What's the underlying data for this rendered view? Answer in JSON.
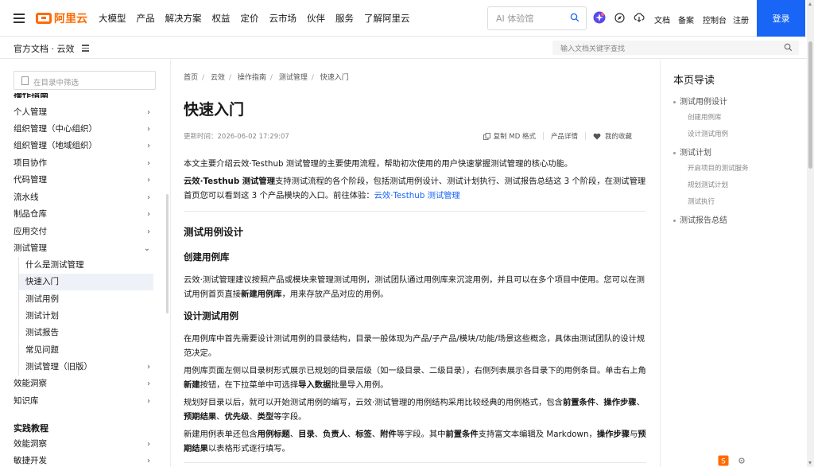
{
  "brand": {
    "logo_text": "阿里云",
    "color": "#ff6a00"
  },
  "topnav": {
    "items": [
      "大模型",
      "产品",
      "解决方案",
      "权益",
      "定价",
      "云市场",
      "伙伴",
      "服务",
      "了解阿里云"
    ],
    "ai_search_placeholder": "AI 体验馆",
    "links": [
      "文档",
      "备案",
      "控制台",
      "注册"
    ],
    "login": "登录",
    "login_color": "#1865f6"
  },
  "subbar": {
    "crumb": "官方文档 · 云效",
    "doc_search_placeholder": "输入文档关键字查找"
  },
  "sidebar": {
    "filter_placeholder": "在目录中筛选",
    "cut_heading": "操作指南",
    "items": [
      {
        "label": "个人管理",
        "chevron": "›"
      },
      {
        "label": "组织管理（中心组织）",
        "chevron": "›"
      },
      {
        "label": "组织管理（地域组织）",
        "chevron": "›"
      },
      {
        "label": "项目协作",
        "chevron": "›"
      },
      {
        "label": "代码管理",
        "chevron": "›"
      },
      {
        "label": "流水线",
        "chevron": "›"
      },
      {
        "label": "制品仓库",
        "chevron": "›"
      },
      {
        "label": "应用交付",
        "chevron": "›"
      },
      {
        "label": "测试管理",
        "chevron": "⌄"
      }
    ],
    "children": [
      {
        "label": "什么是测试管理"
      },
      {
        "label": "快速入门"
      },
      {
        "label": "测试用例"
      },
      {
        "label": "测试计划"
      },
      {
        "label": "测试报告"
      },
      {
        "label": "常见问题"
      },
      {
        "label": "测试管理（旧版）",
        "chevron": "›"
      }
    ],
    "after": [
      {
        "label": "效能洞察",
        "chevron": "›"
      },
      {
        "label": "知识库",
        "chevron": "›"
      }
    ],
    "section2": "实践教程",
    "section2_items": [
      {
        "label": "效能洞察",
        "chevron": "›"
      },
      {
        "label": "敏捷开发",
        "chevron": "›"
      }
    ]
  },
  "main": {
    "breadcrumb": [
      "首页",
      "云效",
      "操作指南",
      "测试管理",
      "快速入门"
    ],
    "title": "快速入门",
    "updated": "更新时间：2026-06-02 17:29:07",
    "actions": {
      "copy": "复制 MD 格式",
      "detail": "产品详情",
      "fav": "我的收藏"
    },
    "intro": "本文主要介绍云效·Testhub 测试管理的主要使用流程，帮助初次使用的用户快速掌握测试管理的核心功能。",
    "p2_bold": "云效·Testhub 测试管理",
    "p2_text": "支持测试流程的各个阶段，包括测试用例设计、测试计划执行、测试报告总结这 3 个阶段，在测试管理首页您可以看到这 3 个产品模块的入口。前往体验：",
    "p2_link": "云效·Testhub 测试管理",
    "h_case_design": "测试用例设计",
    "h_create_lib": "创建用例库",
    "p3_a": "云效·测试管理建议按照产品或模块来管理测试用例，测试团队通过用例库来沉淀用例，并且可以在多个项目中使用。您可以在测试用例首页直接",
    "p3_b": "新建用例库",
    "p3_c": "，用来存放产品对应的用例。",
    "h_design_case": "设计测试用例",
    "p4": "在用例库中首先需要设计测试用例的目录结构，目录一般体现为产品/子产品/模块/功能/场景这些概念，具体由测试团队的设计规范决定。",
    "p5_a": "用例库页面左侧以目录树形式展示已规划的目录层级（如一级目录、二级目录），右侧列表展示各目录下的用例条目。单击右上角",
    "p5_b": "新建",
    "p5_c": "按钮，在下拉菜单中可选择",
    "p5_d": "导入数据",
    "p5_e": "批量导入用例。",
    "p6_a": "规划好目录以后，就可以开始测试用例的编写，云效·测试管理的用例结构采用比较经典的用例格式，包含",
    "p6_b": "前置条件",
    "p6_c": "、",
    "p6_d": "操作步骤",
    "p6_e": "、",
    "p6_f": "预期结果",
    "p6_g": "、",
    "p6_h": "优先级",
    "p6_i": "、",
    "p6_j": "类型",
    "p6_k": "等字段。",
    "p7_a": "新建用例表单还包含",
    "p7_b": "用例标题",
    "p7_c": "、",
    "p7_d": "目录",
    "p7_e": "、",
    "p7_f": "负责人",
    "p7_g": "、",
    "p7_h": "标签",
    "p7_i": "、",
    "p7_j": "附件",
    "p7_k": "等字段。其中",
    "p7_l": "前置条件",
    "p7_m": "支持富文本编辑及 Markdown，",
    "p7_n": "操作步骤",
    "p7_o": "与",
    "p7_p": "预期结果",
    "p7_q": "以表格形式逐行填写。"
  },
  "toc": {
    "title": "本页导读",
    "items": [
      {
        "label": "测试用例设计",
        "subs": [
          "创建用例库",
          "设计测试用例"
        ]
      },
      {
        "label": "测试计划",
        "subs": [
          "开启项目的测试服务",
          "规划测试计划",
          "测试执行"
        ]
      },
      {
        "label": "测试报告总结",
        "subs": []
      }
    ]
  }
}
